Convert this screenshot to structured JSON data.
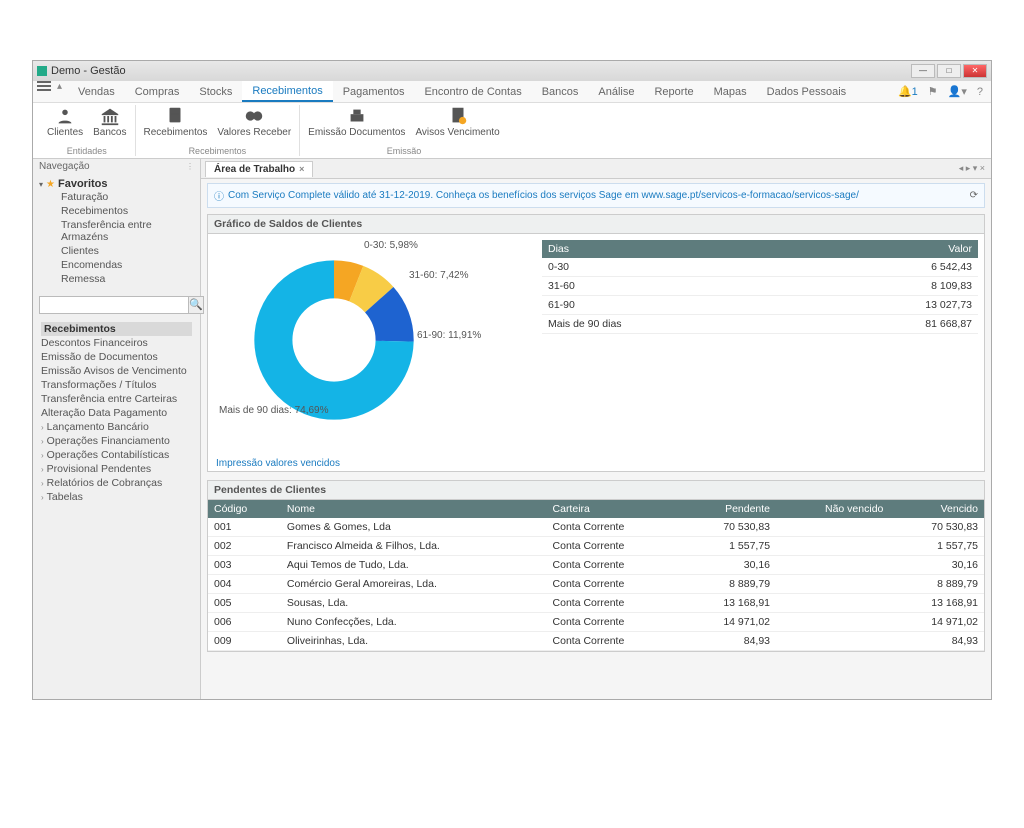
{
  "title": "Demo - Gestão",
  "menu": [
    "Vendas",
    "Compras",
    "Stocks",
    "Recebimentos",
    "Pagamentos",
    "Encontro de Contas",
    "Bancos",
    "Análise",
    "Reporte",
    "Mapas",
    "Dados Pessoais"
  ],
  "active_menu_index": 3,
  "notif_count": "1",
  "ribbon": {
    "g1": {
      "label": "Entidades",
      "btns": [
        "Clientes",
        "Bancos"
      ]
    },
    "g2": {
      "label": "Recebimentos",
      "btns": [
        "Recebimentos",
        "Valores Receber"
      ]
    },
    "g3": {
      "label": "Emissão",
      "btns": [
        "Emissão Documentos",
        "Avisos Vencimento"
      ]
    }
  },
  "sidebar": {
    "title": "Navegação",
    "fav_label": "Favoritos",
    "fav_items": [
      "Faturação",
      "Recebimentos",
      "Transferência entre Armazéns",
      "Clientes",
      "Encomendas",
      "Remessa"
    ],
    "search_placeholder": "",
    "cats": [
      "Recebimentos",
      "Descontos Financeiros",
      "Emissão de Documentos",
      "Emissão Avisos de Vencimento",
      "Transformações / Títulos",
      "Transferência entre Carteiras",
      "Alteração Data Pagamento"
    ],
    "cats_exp": [
      "Lançamento Bancário",
      "Operações Financiamento",
      "Operações Contabilísticas",
      "Provisional Pendentes",
      "Relatórios de Cobranças",
      "Tabelas"
    ]
  },
  "tab_label": "Área de Trabalho",
  "banner": "Com Serviço Complete válido até 31-12-2019. Conheça os benefícios dos serviços Sage em www.sage.pt/servicos-e-formacao/servicos-sage/",
  "panel1_title": "Gráfico de Saldos de Clientes",
  "panel2_title": "Pendentes de Clientes",
  "link_vencidos": "Impressão valores vencidos",
  "chart_data": {
    "type": "pie",
    "title": "Gráfico de Saldos de Clientes",
    "series": [
      {
        "name": "0-30",
        "value": 5.98,
        "label": "0-30: 5,98%",
        "color": "#f5a623"
      },
      {
        "name": "31-60",
        "value": 7.42,
        "label": "31-60: 7,42%",
        "color": "#f8cc46"
      },
      {
        "name": "61-90",
        "value": 11.91,
        "label": "61-90: 11,91%",
        "color": "#1e63d0"
      },
      {
        "name": "Mais de 90 dias",
        "value": 74.69,
        "label": "Mais de 90 dias: 74,69%",
        "color": "#14b4e6"
      }
    ],
    "table_header": [
      "Dias",
      "Valor"
    ],
    "table": [
      {
        "dias": "0-30",
        "valor": "6 542,43"
      },
      {
        "dias": "31-60",
        "valor": "8 109,83"
      },
      {
        "dias": "61-90",
        "valor": "13 027,73"
      },
      {
        "dias": "Mais de 90 dias",
        "valor": "81 668,87"
      }
    ]
  },
  "pendentes": {
    "headers": [
      "Código",
      "Nome",
      "Carteira",
      "Pendente",
      "Não vencido",
      "Vencido"
    ],
    "rows": [
      {
        "cod": "001",
        "nome": "Gomes & Gomes, Lda",
        "cart": "Conta Corrente",
        "pend": "70 530,83",
        "nvenc": "",
        "venc": "70 530,83"
      },
      {
        "cod": "002",
        "nome": "Francisco Almeida & Filhos, Lda.",
        "cart": "Conta Corrente",
        "pend": "1 557,75",
        "nvenc": "",
        "venc": "1 557,75"
      },
      {
        "cod": "003",
        "nome": "Aqui Temos de Tudo, Lda.",
        "cart": "Conta Corrente",
        "pend": "30,16",
        "nvenc": "",
        "venc": "30,16"
      },
      {
        "cod": "004",
        "nome": "Comércio Geral Amoreiras, Lda.",
        "cart": "Conta Corrente",
        "pend": "8 889,79",
        "nvenc": "",
        "venc": "8 889,79"
      },
      {
        "cod": "005",
        "nome": "Sousas, Lda.",
        "cart": "Conta Corrente",
        "pend": "13 168,91",
        "nvenc": "",
        "venc": "13 168,91"
      },
      {
        "cod": "006",
        "nome": "Nuno Confecções, Lda.",
        "cart": "Conta Corrente",
        "pend": "14 971,02",
        "nvenc": "",
        "venc": "14 971,02"
      },
      {
        "cod": "009",
        "nome": "Oliveirinhas, Lda.",
        "cart": "Conta Corrente",
        "pend": "84,93",
        "nvenc": "",
        "venc": "84,93"
      }
    ]
  }
}
